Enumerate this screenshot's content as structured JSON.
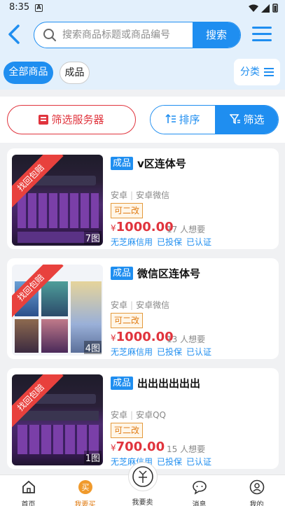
{
  "status_bar": {
    "time": "8:35",
    "notif_icon": "A"
  },
  "header": {
    "search_placeholder": "搜索商品标题或商品编号",
    "search_button": "搜索"
  },
  "categories": {
    "all": "全部商品",
    "done": "成品",
    "classify": "分类"
  },
  "filterbar": {
    "server_filter": "筛选服务器",
    "sort": "排序",
    "filter": "筛选"
  },
  "listings": [
    {
      "ribbon": "找回包赔",
      "image_count": "7图",
      "tag": "成品",
      "title": "v区连体号",
      "platform": "安卓",
      "channel": "安卓微信",
      "badge": "可二改",
      "currency": "¥",
      "price": "1000.00",
      "wants": "17 人想要",
      "services": [
        "无芝麻信用",
        "已投保",
        "已认证"
      ]
    },
    {
      "ribbon": "找回包赔",
      "image_count": "4图",
      "tag": "成品",
      "title": "微信区连体号",
      "platform": "安卓",
      "channel": "安卓微信",
      "badge": "可二改",
      "currency": "¥",
      "price": "1000.00",
      "wants": "13 人想要",
      "services": [
        "无芝麻信用",
        "已投保",
        "已认证"
      ]
    },
    {
      "ribbon": "找回包赔",
      "image_count": "1图",
      "tag": "成品",
      "title": "出出出出出出",
      "platform": "安卓",
      "channel": "安卓QQ",
      "badge": "可二改",
      "currency": "¥",
      "price": "700.00",
      "wants": "15 人想要",
      "services": [
        "无芝麻信用",
        "已投保",
        "已认证"
      ]
    }
  ],
  "tabbar": {
    "home": "首页",
    "buy": "我要买",
    "sell": "我要卖",
    "messages": "消息",
    "mine": "我的"
  },
  "colors": {
    "accent": "#1f8ef0",
    "price": "#e0343d",
    "ribbon": "#e8413d"
  }
}
